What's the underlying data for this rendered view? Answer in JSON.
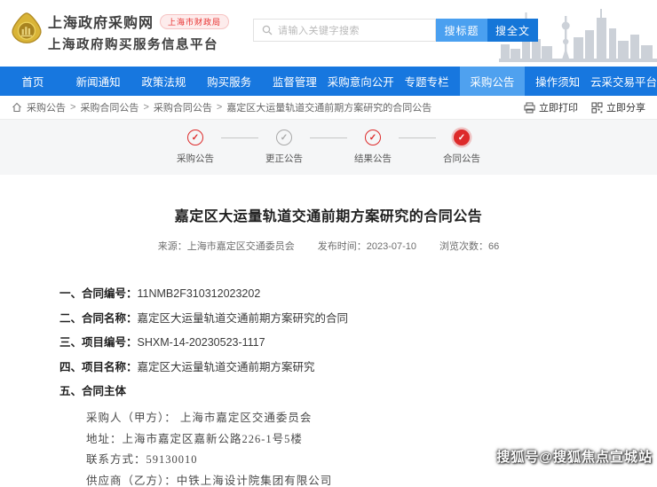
{
  "header": {
    "site_name": "上海政府采购网",
    "site_badge": "上海市财政局",
    "site_subtitle": "上海政府购买服务信息平台",
    "search": {
      "placeholder": "请输入关键字搜索",
      "search_title_label": "搜标题",
      "search_fulltext_label": "搜全文"
    }
  },
  "nav": {
    "items": [
      {
        "label": "首页"
      },
      {
        "label": "新闻通知"
      },
      {
        "label": "政策法规"
      },
      {
        "label": "购买服务"
      },
      {
        "label": "监督管理"
      },
      {
        "label": "采购意向公开"
      },
      {
        "label": "专题专栏"
      },
      {
        "label": "采购公告",
        "active": true
      },
      {
        "label": "操作须知"
      },
      {
        "label": "云采交易平台"
      }
    ]
  },
  "breadcrumb": {
    "separator": ">",
    "items": [
      "采购公告",
      "采购合同公告",
      "采购合同公告",
      "嘉定区大运量轨道交通前期方案研究的合同公告"
    ],
    "print_label": "立即打印",
    "share_label": "立即分享"
  },
  "steps": {
    "items": [
      {
        "label": "采购公告",
        "state": "done"
      },
      {
        "label": "更正公告",
        "state": "inactive"
      },
      {
        "label": "结果公告",
        "state": "done"
      },
      {
        "label": "合同公告",
        "state": "current"
      }
    ]
  },
  "glyphs": {
    "check": "✓"
  },
  "article": {
    "title": "嘉定区大运量轨道交通前期方案研究的合同公告",
    "meta": {
      "source_label": "来源：",
      "source": "上海市嘉定区交通委员会",
      "publish_label": "发布时间：",
      "publish_date": "2023-07-10",
      "views_label": "浏览次数：",
      "views": "66"
    },
    "items": [
      {
        "label": "一、合同编号：",
        "value": "11NMB2F310312023202"
      },
      {
        "label": "二、合同名称：",
        "value": "嘉定区大运量轨道交通前期方案研究的合同"
      },
      {
        "label": "三、项目编号：",
        "value": "SHXM-14-20230523-1117"
      },
      {
        "label": "四、项目名称：",
        "value": "嘉定区大运量轨道交通前期方案研究"
      },
      {
        "label": "五、合同主体",
        "value": ""
      }
    ],
    "sub_items": [
      "采购人（甲方）： 上海市嘉定区交通委员会",
      "地址：上海市嘉定区嘉新公路226-1号5楼",
      "联系方式：59130010",
      "供应商（乙方）：中铁上海设计院集团有限公司"
    ]
  },
  "watermark": "搜狐号@搜狐焦点宣城站",
  "colors": {
    "nav_blue": "#1777df",
    "nav_active_blue": "#4fa1ef",
    "button_light_blue": "#4aa0f0",
    "button_dark_blue": "#1576d8",
    "accent_red": "#dd2a2a",
    "band_gray": "#f5f6f7"
  }
}
